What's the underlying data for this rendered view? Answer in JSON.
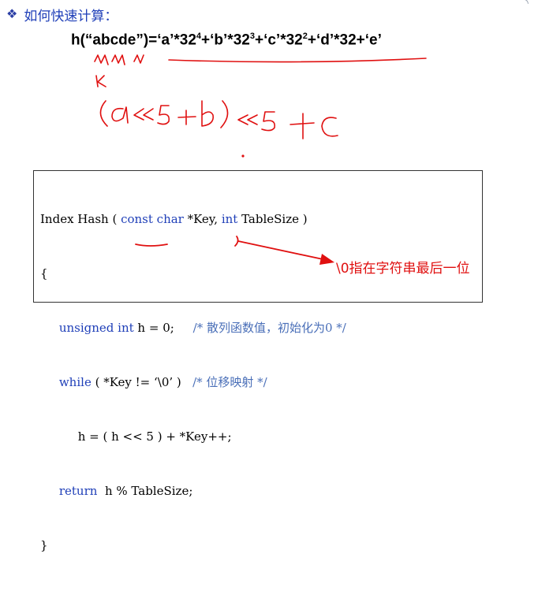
{
  "heading": {
    "bullet": "❖",
    "text": "如何快速计算："
  },
  "formula": {
    "prefix": "h(“abcde”)=‘a’*32",
    "sup1": "4",
    "mid1": "+‘b’*32",
    "sup2": "3",
    "mid2": "+‘c’*32",
    "sup3": "2",
    "tail": "+‘d’*32+‘e’"
  },
  "code": {
    "line1": {
      "a": "Index Hash ( ",
      "kw1": "const char",
      "b": " *Key, ",
      "kw2": "int",
      "c": " TableSize )"
    },
    "line2": "{",
    "line3": {
      "kw": "unsigned int",
      "a": " h = 0;",
      "comment": "/* 散列函数值，初始化为0 */"
    },
    "line4": {
      "kw": "while",
      "a": " ( *Key != ‘\\0’ )",
      "comment": "/* 位移映射 */"
    },
    "line5": "h = ( h << 5 ) + *Key++;",
    "line6": {
      "kw": "return",
      "a": "  h % TableSize;"
    },
    "line7": "}"
  },
  "annotation": {
    "text": "\\0指在字符串最后一位"
  },
  "colors": {
    "accent": "#1f3fb8",
    "ink_red": "#e01010"
  }
}
